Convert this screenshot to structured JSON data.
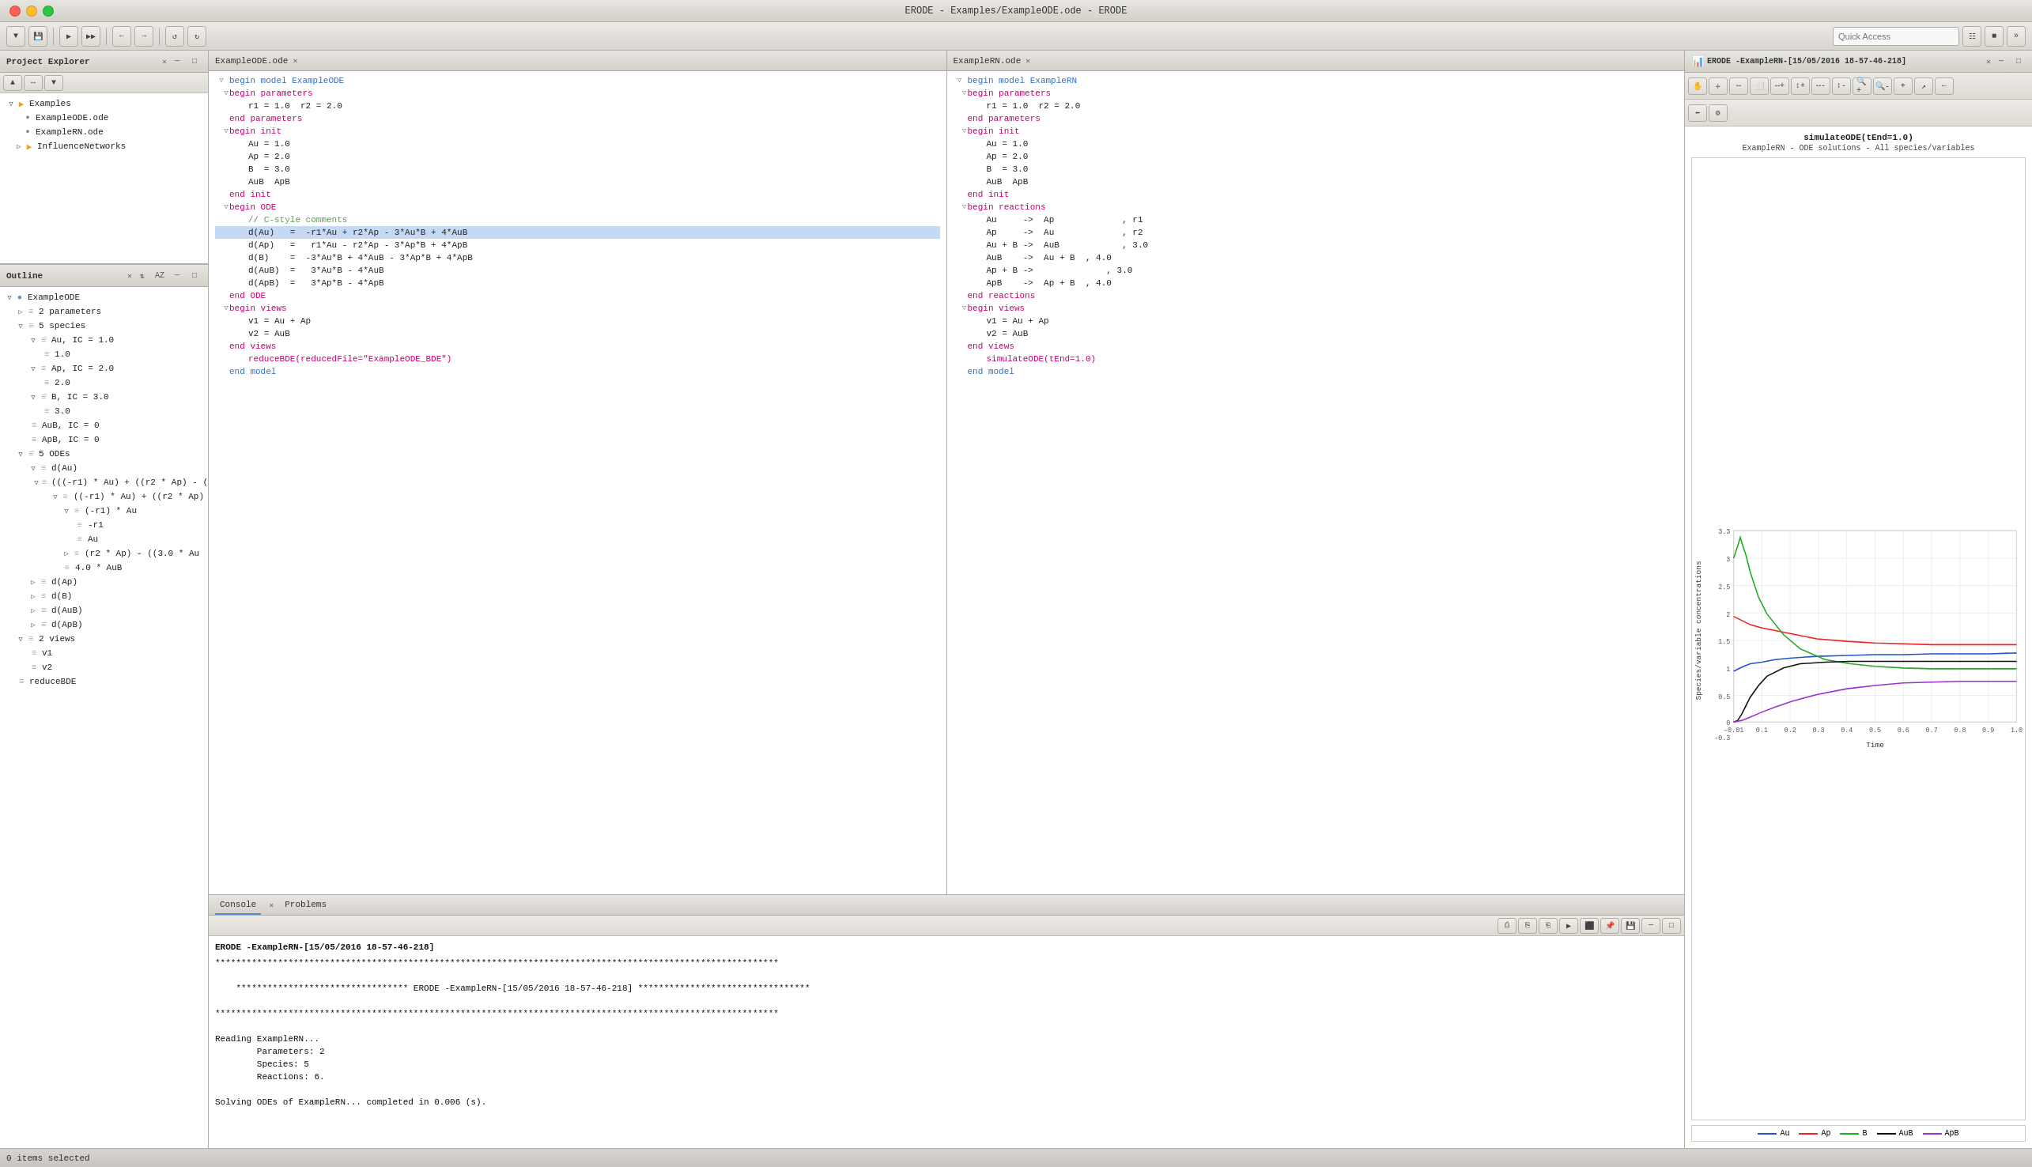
{
  "titleBar": {
    "title": "ERODE - Examples/ExampleODE.ode - ERODE",
    "buttons": [
      "close",
      "minimize",
      "maximize"
    ]
  },
  "toolbar": {
    "quickAccess": {
      "placeholder": "Quick Access",
      "label": "Quick Access"
    }
  },
  "projectExplorer": {
    "title": "Project Explorer",
    "items": [
      {
        "label": "Examples",
        "type": "folder",
        "expanded": true,
        "level": 0
      },
      {
        "label": "ExampleODE.ode",
        "type": "file",
        "level": 1
      },
      {
        "label": "ExampleRN.ode",
        "type": "file",
        "level": 1
      },
      {
        "label": "InfluenceNetworks",
        "type": "folder",
        "expanded": false,
        "level": 1
      }
    ]
  },
  "outline": {
    "title": "Outline",
    "items": [
      {
        "label": "ExampleODE",
        "type": "root",
        "expanded": true,
        "level": 0
      },
      {
        "label": "2 parameters",
        "type": "node",
        "expanded": false,
        "level": 1
      },
      {
        "label": "5 species",
        "type": "node",
        "expanded": true,
        "level": 1
      },
      {
        "label": "Au, IC = 1.0",
        "type": "species",
        "expanded": true,
        "level": 2
      },
      {
        "label": "1.0",
        "type": "value",
        "level": 3
      },
      {
        "label": "Ap, IC = 2.0",
        "type": "species",
        "expanded": true,
        "level": 2
      },
      {
        "label": "2.0",
        "type": "value",
        "level": 3
      },
      {
        "label": "B, IC = 3.0",
        "type": "species",
        "expanded": true,
        "level": 2
      },
      {
        "label": "3.0",
        "type": "value",
        "level": 3
      },
      {
        "label": "AuB, IC = 0",
        "type": "species",
        "level": 2
      },
      {
        "label": "ApB, IC = 0",
        "type": "species",
        "level": 2
      },
      {
        "label": "5 ODEs",
        "type": "node",
        "expanded": true,
        "level": 1
      },
      {
        "label": "d(Au)",
        "type": "ode",
        "expanded": true,
        "level": 2
      },
      {
        "label": "(((-r1) * Au) + ((r2 * Ap) - (",
        "type": "expr",
        "expanded": true,
        "level": 3
      },
      {
        "label": "((-r1) * Au) + ((r2 * Ap)",
        "type": "expr",
        "expanded": true,
        "level": 4
      },
      {
        "label": "(-r1) * Au",
        "type": "expr",
        "expanded": true,
        "level": 5
      },
      {
        "label": "-r1",
        "type": "expr",
        "level": 6
      },
      {
        "label": "Au",
        "type": "expr",
        "level": 6
      },
      {
        "label": "(r2 * Ap) - ((3.0 * Au",
        "type": "expr",
        "level": 5
      },
      {
        "label": "4.0 * AuB",
        "type": "expr",
        "level": 5
      },
      {
        "label": "d(Ap)",
        "type": "ode",
        "level": 2
      },
      {
        "label": "d(B)",
        "type": "ode",
        "level": 2
      },
      {
        "label": "d(AuB)",
        "type": "ode",
        "level": 2
      },
      {
        "label": "d(ApB)",
        "type": "ode",
        "level": 2
      },
      {
        "label": "2 views",
        "type": "node",
        "expanded": true,
        "level": 1
      },
      {
        "label": "v1",
        "type": "view",
        "level": 2
      },
      {
        "label": "v2",
        "type": "view",
        "level": 2
      },
      {
        "label": "reduceBDE",
        "type": "action",
        "level": 1
      }
    ]
  },
  "editorODE": {
    "tabLabel": "ExampleODE.ode",
    "lines": [
      {
        "indent": 0,
        "arrow": "▽",
        "text": "begin model ExampleODE",
        "class": "kw-blue"
      },
      {
        "indent": 1,
        "arrow": "▽",
        "text": "begin parameters",
        "class": "kw-pink"
      },
      {
        "indent": 2,
        "arrow": "",
        "text": "r1 = 1.0  r2 = 2.0",
        "class": "kw-normal"
      },
      {
        "indent": 1,
        "arrow": "",
        "text": "end parameters",
        "class": "kw-pink"
      },
      {
        "indent": 1,
        "arrow": "▽",
        "text": "begin init",
        "class": "kw-pink"
      },
      {
        "indent": 2,
        "arrow": "",
        "text": "Au = 1.0",
        "class": "kw-normal"
      },
      {
        "indent": 2,
        "arrow": "",
        "text": "Ap = 2.0",
        "class": "kw-normal"
      },
      {
        "indent": 2,
        "arrow": "",
        "text": "B  = 3.0",
        "class": "kw-normal"
      },
      {
        "indent": 2,
        "arrow": "",
        "text": "AuB  ApB",
        "class": "kw-normal"
      },
      {
        "indent": 1,
        "arrow": "",
        "text": "end init",
        "class": "kw-pink"
      },
      {
        "indent": 1,
        "arrow": "▽",
        "text": "begin ODE",
        "class": "kw-pink"
      },
      {
        "indent": 2,
        "arrow": "",
        "text": "// C-style comments",
        "class": "kw-comment"
      },
      {
        "indent": 2,
        "arrow": "",
        "text": "d(Au)   =  -r1*Au + r2*Ap - 3*Au*B + 4*AuB",
        "class": "kw-normal",
        "selected": true
      },
      {
        "indent": 2,
        "arrow": "",
        "text": "d(Ap)   =   r1*Au - r2*Ap - 3*Ap*B + 4*ApB",
        "class": "kw-normal"
      },
      {
        "indent": 2,
        "arrow": "",
        "text": "d(B)    =  -3*Au*B + 4*AuB - 3*Ap*B + 4*ApB",
        "class": "kw-normal"
      },
      {
        "indent": 2,
        "arrow": "",
        "text": "d(AuB)  =   3*Au*B - 4*AuB",
        "class": "kw-normal"
      },
      {
        "indent": 2,
        "arrow": "",
        "text": "d(ApB)  =   3*Ap*B - 4*ApB",
        "class": "kw-normal"
      },
      {
        "indent": 1,
        "arrow": "",
        "text": "end ODE",
        "class": "kw-pink"
      },
      {
        "indent": 1,
        "arrow": "▽",
        "text": "begin views",
        "class": "kw-pink"
      },
      {
        "indent": 2,
        "arrow": "",
        "text": "v1 = Au + Ap",
        "class": "kw-normal"
      },
      {
        "indent": 2,
        "arrow": "",
        "text": "v2 = AuB",
        "class": "kw-normal"
      },
      {
        "indent": 1,
        "arrow": "",
        "text": "end views",
        "class": "kw-pink"
      },
      {
        "indent": 2,
        "arrow": "",
        "text": "reduceBDE(reducedFile=\"ExampleODE_BDE\")",
        "class": "kw-pink"
      },
      {
        "indent": 0,
        "arrow": "",
        "text": "end model",
        "class": "kw-blue"
      }
    ]
  },
  "editorRN": {
    "tabLabel": "ExampleRN.ode",
    "lines": [
      {
        "indent": 0,
        "arrow": "▽",
        "text": "begin model ExampleRN",
        "class": "kw-blue"
      },
      {
        "indent": 1,
        "arrow": "▽",
        "text": "begin parameters",
        "class": "kw-pink"
      },
      {
        "indent": 2,
        "arrow": "",
        "text": "r1 = 1.0  r2 = 2.0",
        "class": "kw-normal"
      },
      {
        "indent": 1,
        "arrow": "",
        "text": "end parameters",
        "class": "kw-pink"
      },
      {
        "indent": 1,
        "arrow": "▽",
        "text": "begin init",
        "class": "kw-pink"
      },
      {
        "indent": 2,
        "arrow": "",
        "text": "Au = 1.0",
        "class": "kw-normal"
      },
      {
        "indent": 2,
        "arrow": "",
        "text": "Ap = 2.0",
        "class": "kw-normal"
      },
      {
        "indent": 2,
        "arrow": "",
        "text": "B  = 3.0",
        "class": "kw-normal"
      },
      {
        "indent": 2,
        "arrow": "",
        "text": "AuB  ApB",
        "class": "kw-normal"
      },
      {
        "indent": 1,
        "arrow": "",
        "text": "end init",
        "class": "kw-pink"
      },
      {
        "indent": 1,
        "arrow": "▽",
        "text": "begin reactions",
        "class": "kw-pink"
      },
      {
        "indent": 2,
        "arrow": "",
        "text": "Au     ->  Ap            , r1",
        "class": "kw-normal"
      },
      {
        "indent": 2,
        "arrow": "",
        "text": "Ap     ->  Au            , r2",
        "class": "kw-normal"
      },
      {
        "indent": 2,
        "arrow": "",
        "text": "Au + B ->  AuB           , 3.0",
        "class": "kw-normal"
      },
      {
        "indent": 2,
        "arrow": "",
        "text": "AuB    ->  Au + B  , 4.0",
        "class": "kw-normal"
      },
      {
        "indent": 2,
        "arrow": "",
        "text": "Ap + B ->            , 3.0",
        "class": "kw-normal"
      },
      {
        "indent": 2,
        "arrow": "",
        "text": "ApB    ->  Ap + B  , 4.0",
        "class": "kw-normal"
      },
      {
        "indent": 1,
        "arrow": "",
        "text": "end reactions",
        "class": "kw-pink"
      },
      {
        "indent": 1,
        "arrow": "▽",
        "text": "begin views",
        "class": "kw-pink"
      },
      {
        "indent": 2,
        "arrow": "",
        "text": "v1 = Au + Ap",
        "class": "kw-normal"
      },
      {
        "indent": 2,
        "arrow": "",
        "text": "v2 = AuB",
        "class": "kw-normal"
      },
      {
        "indent": 1,
        "arrow": "",
        "text": "end views",
        "class": "kw-pink"
      },
      {
        "indent": 2,
        "arrow": "",
        "text": "simulateODE(tEnd=1.0)",
        "class": "kw-pink"
      },
      {
        "indent": 0,
        "arrow": "",
        "text": "end model",
        "class": "kw-blue"
      }
    ]
  },
  "console": {
    "tabs": [
      {
        "label": "Console",
        "active": true
      },
      {
        "label": "Problems",
        "active": false
      }
    ],
    "runTitle": "ERODE -ExampleRN-[15/05/2016 18-57-46-218]",
    "lines": [
      "************************************************************************************************************",
      "",
      "    ********************************* ERODE -ExampleRN-[15/05/2016 18-57-46-218] *********************************",
      "",
      "************************************************************************************************************",
      "",
      "Reading ExampleRN...",
      "        Parameters: 2",
      "        Species: 5",
      "        Reactions: 6.",
      "",
      "Solving ODEs of ExampleRN... completed in 0.006 (s)."
    ]
  },
  "chart": {
    "panelTitle": "ERODE -ExampleRN-[15/05/2016 18-57-46-218]",
    "title": "simulateODE(tEnd=1.0)",
    "subtitle": "ExampleRN - ODE solutions - All species/variables",
    "yLabel": "Species/variable concentrations",
    "xLabel": "Time",
    "yMin": -0.3,
    "yMax": 3.3,
    "xMin": -0.01,
    "xMax": 1.0,
    "legend": [
      {
        "label": "Au",
        "color": "#2255cc"
      },
      {
        "label": "Ap",
        "color": "#ee2222"
      },
      {
        "label": "B",
        "color": "#22aa22"
      },
      {
        "label": "AuB",
        "color": "#111111"
      },
      {
        "label": "ApB",
        "color": "#9933cc"
      }
    ]
  },
  "statusBar": {
    "text": "0 items selected"
  }
}
